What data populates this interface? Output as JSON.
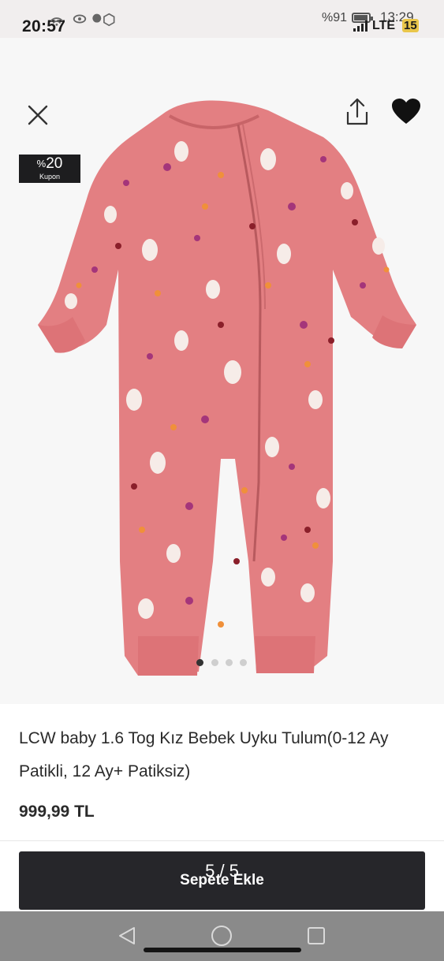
{
  "status_bar": {
    "time_primary": "20:57",
    "time_secondary": "13:29",
    "battery": "%91",
    "network": "LTE",
    "badge": "15"
  },
  "header": {
    "close_icon": "close-icon",
    "share_icon": "share-icon",
    "favorite_icon": "heart-icon"
  },
  "coupon": {
    "prefix": "%",
    "value": "20",
    "label": "Kupon"
  },
  "gallery": {
    "image_count": 4,
    "active_index": 0
  },
  "product": {
    "title": "LCW baby 1.6  Tog Kız Bebek Uyku Tulum(0-12 Ay Patikli, 12 Ay+ Patiksiz)",
    "price": "999,99 TL"
  },
  "cta": {
    "label": "Sepete Ekle",
    "page_indicator": "5 / 5"
  },
  "colors": {
    "garment": "#e37f82",
    "cta_bg": "#26262a",
    "coupon_bg": "#1d1d1f"
  }
}
